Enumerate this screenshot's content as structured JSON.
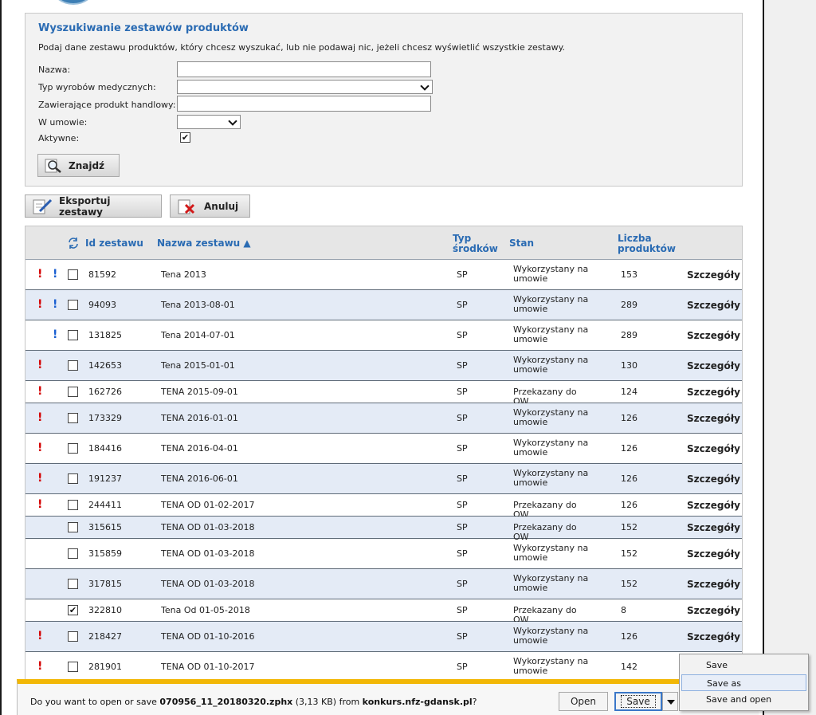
{
  "search": {
    "title": "Wyszukiwanie zestawów produktów",
    "description": "Podaj dane zestawu produktów, który chcesz wyszukać, lub nie podawaj nic, jeżeli chcesz wyświetlić wszystkie zestawy.",
    "fields": {
      "name_label": "Nazwa:",
      "name_value": "",
      "type_label": "Typ wyrobów medycznych:",
      "type_value": "",
      "product_label": "Zawierające produkt handlowy:",
      "product_value": "",
      "contract_label": "W umowie:",
      "contract_value": "",
      "active_label": "Aktywne:",
      "active_checked": true
    },
    "find_button": "Znajdź"
  },
  "actions": {
    "export_button": "Eksportuj zestawy",
    "cancel_button": "Anuluj"
  },
  "table": {
    "headers": {
      "id": "Id zestawu",
      "name": "Nazwa zestawu ▲",
      "type_line1": "Typ",
      "type_line2": "środków",
      "status": "Stan",
      "count_line1": "Liczba",
      "count_line2": "produktów"
    },
    "details_label": "Szczegóły",
    "rows": [
      {
        "red": true,
        "blue": true,
        "checked": false,
        "id": "81592",
        "name": "Tena 2013",
        "type": "SP",
        "status": "Wykorzystany na umowie",
        "count": "153"
      },
      {
        "red": true,
        "blue": true,
        "checked": false,
        "id": "94093",
        "name": "Tena 2013-08-01",
        "type": "SP",
        "status": "Wykorzystany na umowie",
        "count": "289"
      },
      {
        "red": false,
        "blue": true,
        "checked": false,
        "id": "131825",
        "name": "Tena 2014-07-01",
        "type": "SP",
        "status": "Wykorzystany na umowie",
        "count": "289"
      },
      {
        "red": true,
        "blue": false,
        "checked": false,
        "id": "142653",
        "name": "Tena 2015-01-01",
        "type": "SP",
        "status": "Wykorzystany na umowie",
        "count": "130"
      },
      {
        "red": true,
        "blue": false,
        "checked": false,
        "id": "162726",
        "name": "TENA 2015-09-01",
        "type": "SP",
        "status": "Przekazany do OW",
        "count": "124"
      },
      {
        "red": true,
        "blue": false,
        "checked": false,
        "id": "173329",
        "name": "TENA 2016-01-01",
        "type": "SP",
        "status": "Wykorzystany na umowie",
        "count": "126"
      },
      {
        "red": true,
        "blue": false,
        "checked": false,
        "id": "184416",
        "name": "TENA 2016-04-01",
        "type": "SP",
        "status": "Wykorzystany na umowie",
        "count": "126"
      },
      {
        "red": true,
        "blue": false,
        "checked": false,
        "id": "191237",
        "name": "TENA 2016-06-01",
        "type": "SP",
        "status": "Wykorzystany na umowie",
        "count": "126"
      },
      {
        "red": true,
        "blue": false,
        "checked": false,
        "id": "244411",
        "name": "TENA OD 01-02-2017",
        "type": "SP",
        "status": "Przekazany do OW",
        "count": "126"
      },
      {
        "red": false,
        "blue": false,
        "checked": false,
        "id": "315615",
        "name": "TENA OD 01-03-2018",
        "type": "SP",
        "status": "Przekazany do OW",
        "count": "152"
      },
      {
        "red": false,
        "blue": false,
        "checked": false,
        "id": "315859",
        "name": "TENA OD 01-03-2018",
        "type": "SP",
        "status": "Wykorzystany na umowie",
        "count": "152"
      },
      {
        "red": false,
        "blue": false,
        "checked": false,
        "id": "317815",
        "name": "TENA OD 01-03-2018",
        "type": "SP",
        "status": "Wykorzystany na umowie",
        "count": "152"
      },
      {
        "red": false,
        "blue": false,
        "checked": true,
        "id": "322810",
        "name": "Tena Od 01-05-2018",
        "type": "SP",
        "status": "Przekazany do OW",
        "count": "8"
      },
      {
        "red": true,
        "blue": false,
        "checked": false,
        "id": "218427",
        "name": "TENA OD 01-10-2016",
        "type": "SP",
        "status": "Wykorzystany na umowie",
        "count": "126"
      },
      {
        "red": true,
        "blue": false,
        "checked": false,
        "id": "281901",
        "name": "TENA OD 01-10-2017",
        "type": "SP",
        "status": "Wykorzystany na umowie",
        "count": "142"
      }
    ]
  },
  "download": {
    "prefix": "Do you want to open or save ",
    "filename": "070956_11_20180320.zphx",
    "size": " (3,13 KB) from ",
    "host": "konkurs.nfz-gdansk.pl",
    "suffix": "?",
    "open_button": "Open",
    "save_button": "Save",
    "menu": [
      "Save",
      "Save as",
      "Save and open"
    ]
  },
  "colors": {
    "accent": "#2a6bb3",
    "alert_red": "#d40000",
    "alert_blue": "#1a5fd1",
    "row_alt": "#e4ebf6",
    "notification_bar": "#f2b705"
  }
}
